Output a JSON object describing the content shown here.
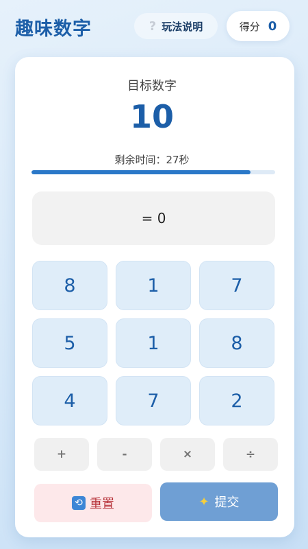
{
  "header": {
    "title": "趣味数字",
    "help_icon": "?",
    "help_label": "玩法说明",
    "score_label": "得分",
    "score_value": "0"
  },
  "game": {
    "target_label": "目标数字",
    "target_value": "10",
    "timer_text": "剩余时间：27秒",
    "time_remaining_fraction": 0.9,
    "expression": "= 0"
  },
  "numbers": [
    "8",
    "1",
    "7",
    "5",
    "1",
    "8",
    "4",
    "7",
    "2"
  ],
  "operators": [
    "+",
    "-",
    "×",
    "÷"
  ],
  "actions": {
    "reset_icon": "🔄",
    "reset_label": "重置",
    "submit_icon": "✨",
    "submit_label": "提交"
  },
  "colors": {
    "accent": "#1c5ea8",
    "progress": "#2a78c8",
    "reset_bg": "#fde8ea",
    "reset_text": "#b7333a",
    "submit_bg": "#6f9fd4"
  }
}
